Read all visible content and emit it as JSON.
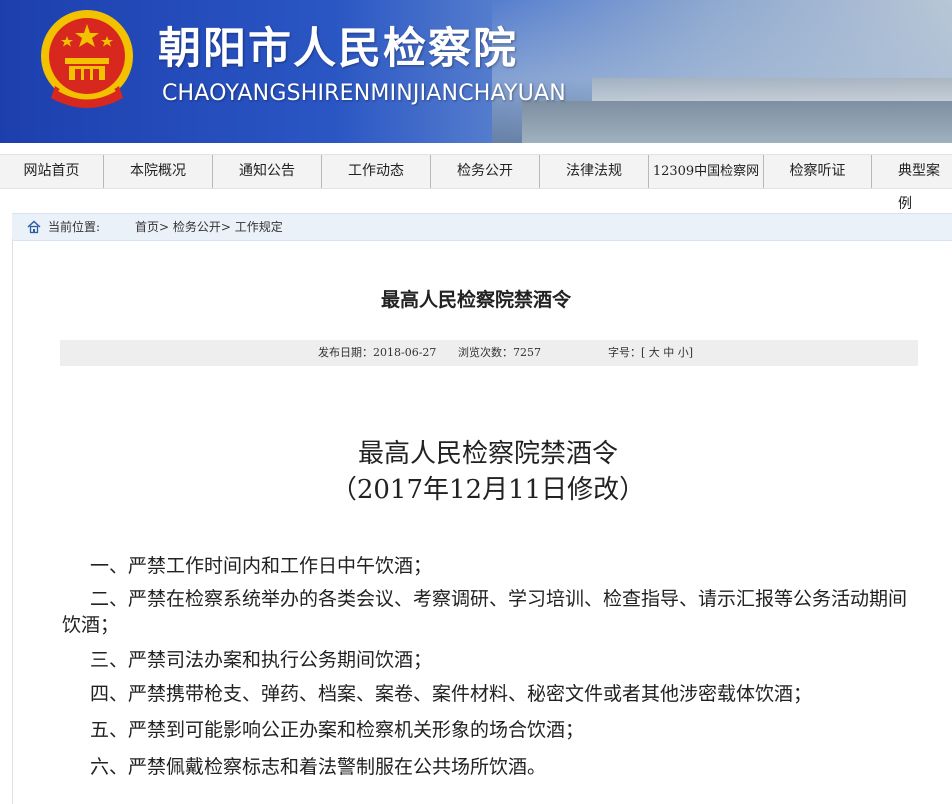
{
  "header": {
    "title": "朝阳市人民检察院",
    "subtitle": "CHAOYANGSHIRENMINJIANCHAYUAN",
    "colors": {
      "banner_blue": "#1d3fae",
      "emblem_red": "#d8271e",
      "emblem_gold": "#f2c200"
    }
  },
  "nav": {
    "items": [
      {
        "label": "网站首页"
      },
      {
        "label": "本院概况"
      },
      {
        "label": "通知公告"
      },
      {
        "label": "工作动态"
      },
      {
        "label": "检务公开"
      },
      {
        "label": "法律法规"
      },
      {
        "label": "12309中国检察网"
      },
      {
        "label": "检察听证"
      },
      {
        "label": "典型案例"
      }
    ]
  },
  "location": {
    "label": "当前位置:",
    "crumbs": [
      "首页>",
      "检务公开>",
      "工作规定"
    ]
  },
  "article": {
    "title": "最高人民检察院禁酒令",
    "meta": {
      "date": "发布日期：2018-06-27",
      "views": "浏览次数：7257",
      "font_label": "字号：[",
      "font_large": "大",
      "font_medium": "中",
      "font_small": "小",
      "font_close": "]"
    },
    "doc_title_line1": "最高人民检察院禁酒令",
    "doc_title_line2": "（2017年12月11日修改）",
    "paragraphs": [
      "一、严禁工作时间内和工作日中午饮酒；",
      "二、严禁在检察系统举办的各类会议、考察调研、学习培训、检查指导、请示汇报等公务活动期间饮酒；",
      "三、严禁司法办案和执行公务期间饮酒；",
      "四、严禁携带枪支、弹药、档案、案卷、案件材料、秘密文件或者其他涉密载体饮酒；",
      "五、严禁到可能影响公正办案和检察机关形象的场合饮酒；",
      "六、严禁佩戴检察标志和着法警制服在公共场所饮酒。"
    ]
  }
}
